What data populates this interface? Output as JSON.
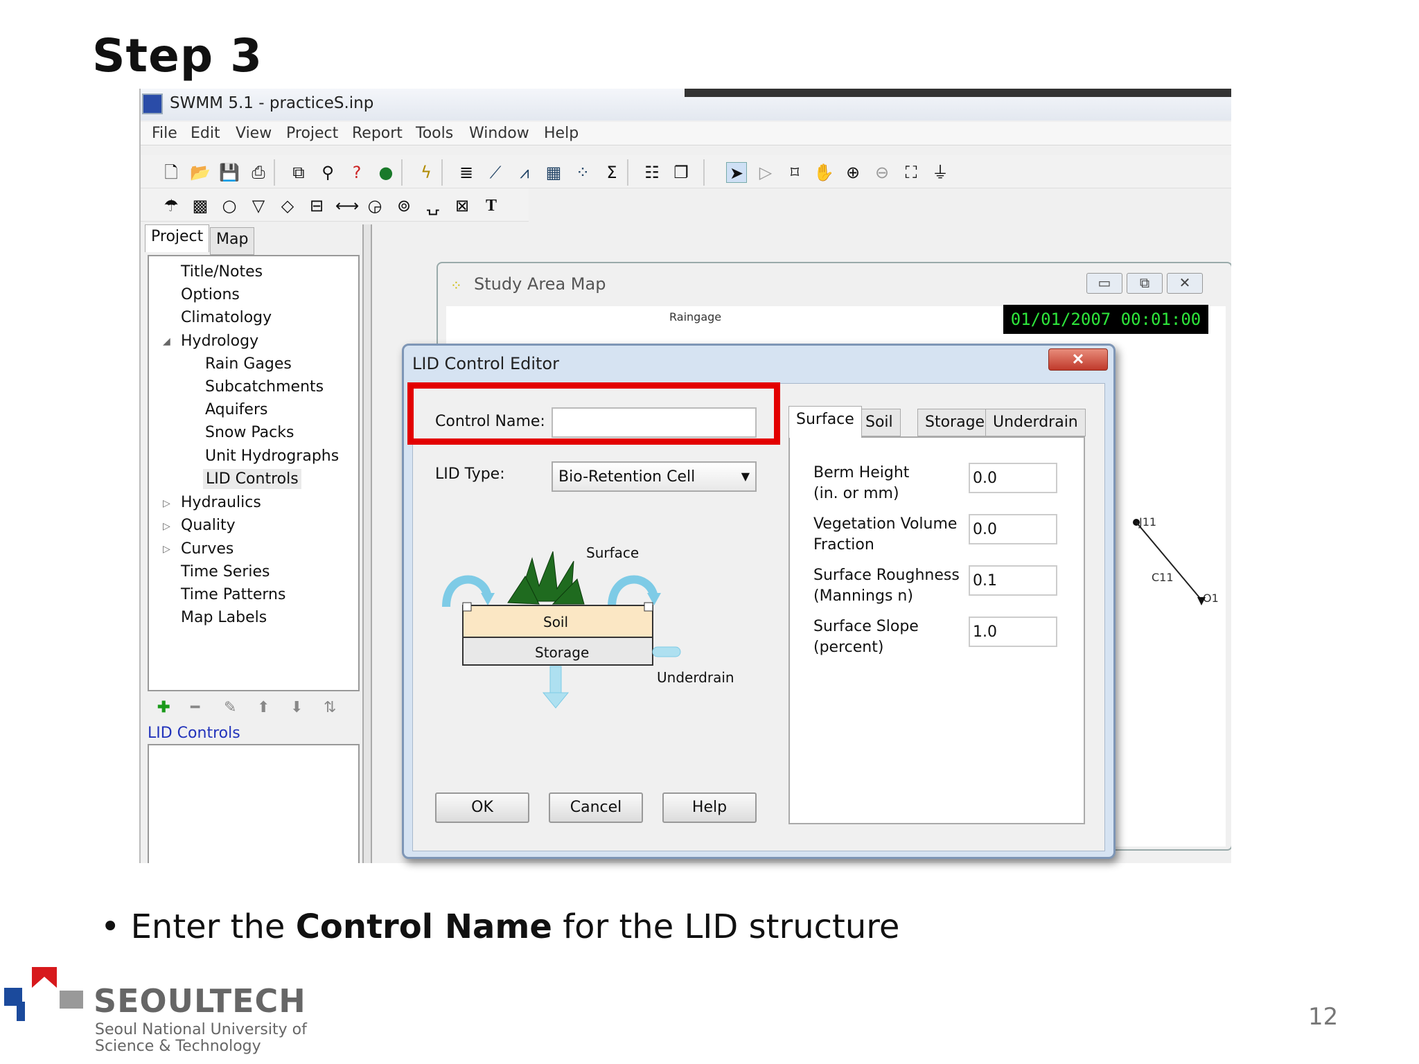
{
  "slide": {
    "title": "Step 3",
    "bullet_prefix": "• Enter the ",
    "bullet_bold": "Control Name",
    "bullet_suffix": " for the LID structure",
    "page_number": "12",
    "logo_name": "SEOULTECH",
    "logo_sub1": "Seoul National University of",
    "logo_sub2": "Science & Technology"
  },
  "app": {
    "title": "SWMM 5.1 - practiceS.inp",
    "menu": [
      "File",
      "Edit",
      "View",
      "Project",
      "Report",
      "Tools",
      "Window",
      "Help"
    ],
    "toolbar1_icons": [
      "new-file-icon",
      "open-folder-icon",
      "save-icon",
      "print-icon",
      "copy-icon",
      "find-icon",
      "query-icon",
      "overview-map-icon",
      "run-icon",
      "report-icon",
      "profile-plot-icon",
      "time-series-plot-icon",
      "table-icon",
      "scatter-plot-icon",
      "statistics-icon",
      "options-icon",
      "arrange-windows-icon",
      "select-object-icon",
      "select-vertex-icon",
      "select-region-icon",
      "pan-icon",
      "zoom-in-icon",
      "zoom-out-icon",
      "full-extent-icon",
      "measure-icon"
    ],
    "toolbar2_icons": [
      "rain-gage-icon",
      "subcatchment-icon",
      "junction-icon",
      "outfall-icon",
      "divider-icon",
      "storage-unit-icon",
      "conduit-icon",
      "pump-icon",
      "orifice-icon",
      "weir-icon",
      "outlet-icon",
      "label-icon"
    ]
  },
  "left_panel": {
    "tabs": [
      "Project",
      "Map"
    ],
    "tree": [
      "Title/Notes",
      "Options",
      "Climatology",
      "Hydrology",
      "Rain Gages",
      "Subcatchments",
      "Aquifers",
      "Snow Packs",
      "Unit Hydrographs",
      "LID Controls",
      "Hydraulics",
      "Quality",
      "Curves",
      "Time Series",
      "Time Patterns",
      "Map Labels"
    ],
    "selected_label": "LID Controls"
  },
  "map": {
    "title": "Study Area Map",
    "time": "01/01/2007 00:01:00",
    "labels": {
      "raingage": "Raingage",
      "j11": "J11",
      "c11": "C11",
      "o1": "O1"
    }
  },
  "dialog": {
    "title": "LID Control Editor",
    "control_name_label": "Control Name:",
    "control_name_value": "",
    "lid_type_label": "LID Type:",
    "lid_type_value": "Bio-Retention Cell",
    "diagram": {
      "surface": "Surface",
      "soil": "Soil",
      "storage": "Storage",
      "underdrain": "Underdrain"
    },
    "buttons": {
      "ok": "OK",
      "cancel": "Cancel",
      "help": "Help"
    },
    "tabs": [
      "Surface",
      "Soil",
      "Storage",
      "Underdrain"
    ],
    "fields": [
      {
        "line1": "Berm Height",
        "line2": "(in. or mm)",
        "value": "0.0"
      },
      {
        "line1": "Vegetation Volume",
        "line2": "Fraction",
        "value": "0.0"
      },
      {
        "line1": "Surface Roughness",
        "line2": "(Mannings n)",
        "value": "0.1"
      },
      {
        "line1": "Surface Slope",
        "line2": "(percent)",
        "value": "1.0"
      }
    ]
  },
  "colors": {
    "highlight": "#e30000",
    "clock_text": "#2ee63b",
    "selected_link": "#2233bb"
  }
}
